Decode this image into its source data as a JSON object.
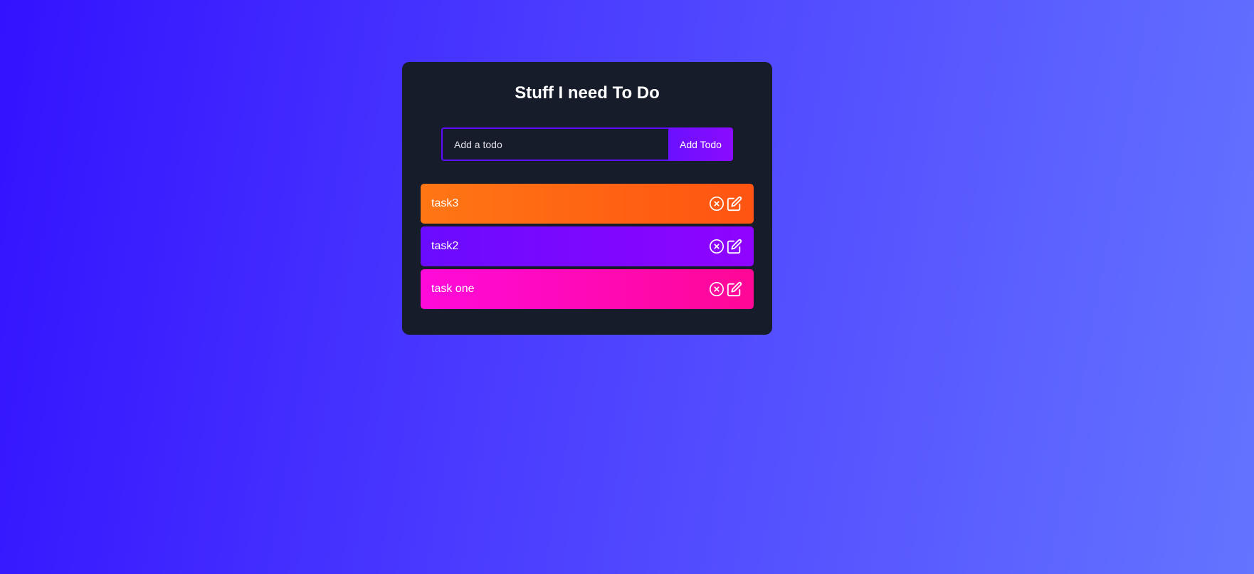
{
  "app": {
    "title": "Stuff I need To Do"
  },
  "form": {
    "input_placeholder": "Add a todo",
    "input_value": "",
    "button_label": "Add Todo"
  },
  "todos": [
    {
      "text": "task3",
      "color": "#ff6a14",
      "delete_icon": "circle-x-icon",
      "edit_icon": "pencil-edit-icon"
    },
    {
      "text": "task2",
      "color": "#7a08ff",
      "delete_icon": "circle-x-icon",
      "edit_icon": "pencil-edit-icon"
    },
    {
      "text": "task one",
      "color": "#ff09c0",
      "delete_icon": "circle-x-icon",
      "edit_icon": "pencil-edit-icon"
    }
  ],
  "colors": {
    "background_start": "#3312ff",
    "background_end": "#6474ff",
    "panel": "#171c2b",
    "accent": "#5d0cff"
  }
}
